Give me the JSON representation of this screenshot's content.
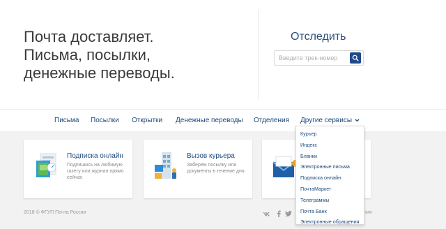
{
  "hero": {
    "tagline_lines": [
      "Почта доставляет.",
      "Письма, посылки,",
      "денежные переводы."
    ],
    "track_title": "Отследить",
    "track_placeholder": "Введите трек-номер"
  },
  "nav": {
    "items": [
      "Письма",
      "Посылки",
      "Открытки",
      "Денежные переводы",
      "Отделения",
      "Другие сервисы"
    ]
  },
  "cards": [
    {
      "title": "Подписка онлайн",
      "desc": "Подпишись на любимую газету или журнал прямо сейчас"
    },
    {
      "title": "Вызов курьера",
      "desc": "Заберем посылку или документы в течение дня"
    },
    {
      "title": "",
      "desc": ""
    }
  ],
  "dropdown": {
    "items": [
      "Курьер",
      "Индекс",
      "Бланки",
      "Электронные письма",
      "Подписка онлайн",
      "ПочтаМаркет",
      "Телеграммы",
      "Почта Банк",
      "Электронные обращения"
    ]
  },
  "footer": {
    "copyright": "2018 © ФГУП Почта России",
    "tail": "ния",
    "social": [
      "vk-icon",
      "facebook-icon",
      "twitter-icon"
    ]
  },
  "colors": {
    "brand_blue": "#1f4a8a",
    "link_blue": "#1d4a7d",
    "background": "#f2f2f2"
  }
}
